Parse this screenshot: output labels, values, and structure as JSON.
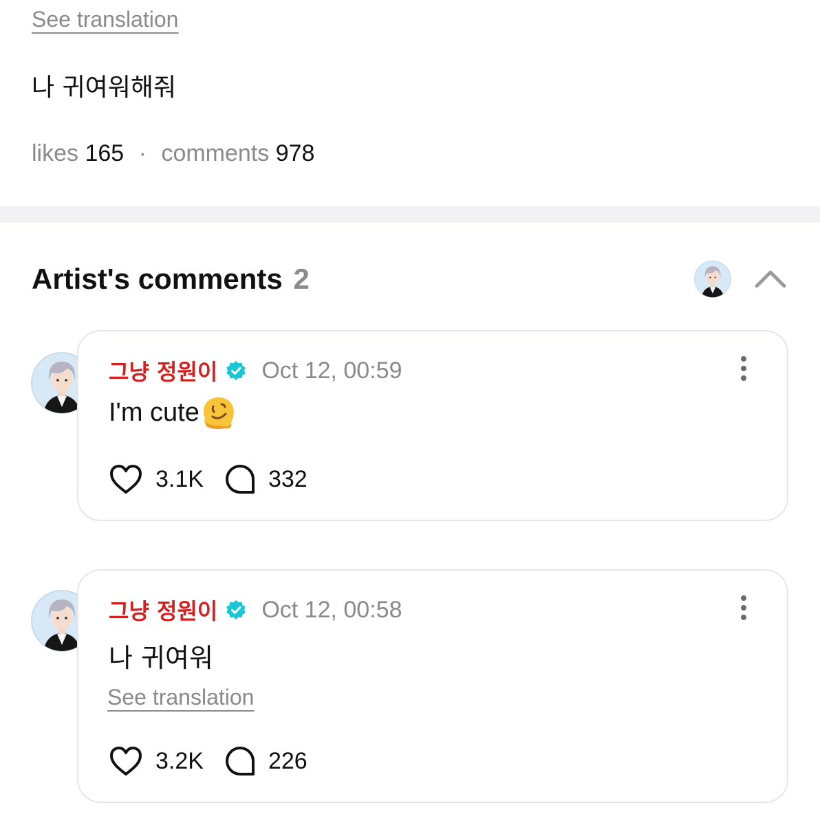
{
  "post": {
    "see_translation": "See translation",
    "body": "나 귀여워해줘",
    "likes_label": "likes",
    "likes_count": "165",
    "separator": "·",
    "comments_label": "comments",
    "comments_count": "978"
  },
  "artist_comments": {
    "title": "Artist's comments",
    "count": "2",
    "collapse_icon": "chevron-up-icon"
  },
  "comments": [
    {
      "author": "그냥 정원이",
      "time": "Oct 12, 00:59",
      "text": "I'm cute",
      "emoji": "melting-face",
      "likes": "3.1K",
      "replies": "332"
    },
    {
      "author": "그냥 정원이",
      "time": "Oct 12, 00:58",
      "text": "나 귀여워",
      "see_translation": "See translation",
      "likes": "3.2K",
      "replies": "226"
    }
  ],
  "colors": {
    "author": "#d42020",
    "verified": "#18c6d6",
    "muted": "#8a8a8a",
    "card_border": "#e6e6ea",
    "divider": "#f2f2f4"
  }
}
